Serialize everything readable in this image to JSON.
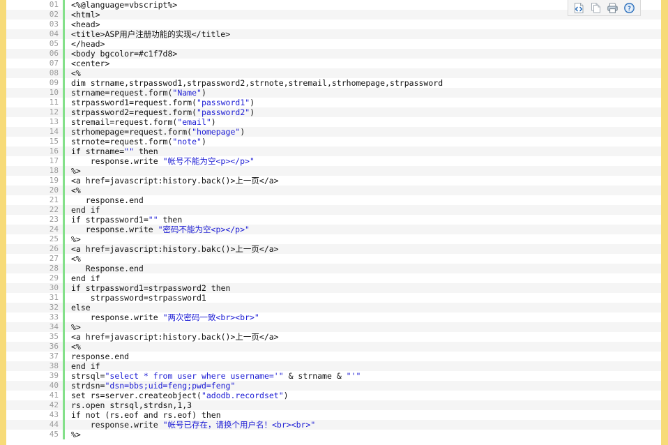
{
  "toolbar": {
    "buttons": [
      {
        "name": "view-source-icon",
        "label": "View Source",
        "color": "#2a6ebb"
      },
      {
        "name": "copy-icon",
        "label": "Copy",
        "color": "#9aa4ad"
      },
      {
        "name": "print-icon",
        "label": "Print",
        "color": "#7d8a96"
      },
      {
        "name": "help-icon",
        "label": "Help",
        "color": "#2a6ebb"
      }
    ]
  },
  "editor": {
    "language": "asp-vbscript",
    "line_number_start": 1,
    "line_number_format": "2-digit",
    "gutter_accent_color": "#84e08a",
    "edge_stripe_color": "#f7db78",
    "alt_row_color": "#f5f5f5",
    "string_color": "#1b1bd4",
    "text_color": "#101010",
    "line_number_color": "#999999",
    "lines": [
      {
        "n": "01",
        "parts": [
          {
            "t": "plain",
            "v": "<%@language=vbscript%>"
          }
        ]
      },
      {
        "n": "02",
        "parts": [
          {
            "t": "plain",
            "v": "<html>"
          }
        ]
      },
      {
        "n": "03",
        "parts": [
          {
            "t": "plain",
            "v": "<head>"
          }
        ]
      },
      {
        "n": "04",
        "parts": [
          {
            "t": "plain",
            "v": "<title>ASP用户注册功能的实现</title>"
          }
        ]
      },
      {
        "n": "05",
        "parts": [
          {
            "t": "plain",
            "v": "</head>"
          }
        ]
      },
      {
        "n": "06",
        "parts": [
          {
            "t": "plain",
            "v": "<body bgcolor=#c1f7d8>"
          }
        ]
      },
      {
        "n": "07",
        "parts": [
          {
            "t": "plain",
            "v": "<center>"
          }
        ]
      },
      {
        "n": "08",
        "parts": [
          {
            "t": "plain",
            "v": "<%"
          }
        ]
      },
      {
        "n": "09",
        "parts": [
          {
            "t": "plain",
            "v": "dim strname,strpasswod1,strpassword2,strnote,stremail,strhomepage,strpassword"
          }
        ]
      },
      {
        "n": "10",
        "parts": [
          {
            "t": "plain",
            "v": "strname=request.form("
          },
          {
            "t": "str",
            "v": "\"Name\""
          },
          {
            "t": "plain",
            "v": ")"
          }
        ]
      },
      {
        "n": "11",
        "parts": [
          {
            "t": "plain",
            "v": "strpassword1=request.form("
          },
          {
            "t": "str",
            "v": "\"password1\""
          },
          {
            "t": "plain",
            "v": ")"
          }
        ]
      },
      {
        "n": "12",
        "parts": [
          {
            "t": "plain",
            "v": "strpassword2=request.form("
          },
          {
            "t": "str",
            "v": "\"password2\""
          },
          {
            "t": "plain",
            "v": ")"
          }
        ]
      },
      {
        "n": "13",
        "parts": [
          {
            "t": "plain",
            "v": "stremail=request.form("
          },
          {
            "t": "str",
            "v": "\"email\""
          },
          {
            "t": "plain",
            "v": ")"
          }
        ]
      },
      {
        "n": "14",
        "parts": [
          {
            "t": "plain",
            "v": "strhomepage=request.form("
          },
          {
            "t": "str",
            "v": "\"homepage\""
          },
          {
            "t": "plain",
            "v": ")"
          }
        ]
      },
      {
        "n": "15",
        "parts": [
          {
            "t": "plain",
            "v": "strnote=request.form("
          },
          {
            "t": "str",
            "v": "\"note\""
          },
          {
            "t": "plain",
            "v": ")"
          }
        ]
      },
      {
        "n": "16",
        "parts": [
          {
            "t": "plain",
            "v": "if strname="
          },
          {
            "t": "str",
            "v": "\"\""
          },
          {
            "t": "plain",
            "v": " then"
          }
        ]
      },
      {
        "n": "17",
        "parts": [
          {
            "t": "plain",
            "v": "    response.write "
          },
          {
            "t": "str",
            "v": "\"帐号不能为空<p></p>\""
          }
        ]
      },
      {
        "n": "18",
        "parts": [
          {
            "t": "plain",
            "v": "%>"
          }
        ]
      },
      {
        "n": "19",
        "parts": [
          {
            "t": "plain",
            "v": "<a href=javascript:history.back()>上一页</a>"
          }
        ]
      },
      {
        "n": "20",
        "parts": [
          {
            "t": "plain",
            "v": "<%"
          }
        ]
      },
      {
        "n": "21",
        "parts": [
          {
            "t": "plain",
            "v": "   response.end"
          }
        ]
      },
      {
        "n": "22",
        "parts": [
          {
            "t": "plain",
            "v": "end if"
          }
        ]
      },
      {
        "n": "23",
        "parts": [
          {
            "t": "plain",
            "v": "if strpassword1="
          },
          {
            "t": "str",
            "v": "\"\""
          },
          {
            "t": "plain",
            "v": " then"
          }
        ]
      },
      {
        "n": "24",
        "parts": [
          {
            "t": "plain",
            "v": "   response.write "
          },
          {
            "t": "str",
            "v": "\"密码不能为空<p></p>\""
          }
        ]
      },
      {
        "n": "25",
        "parts": [
          {
            "t": "plain",
            "v": "%>"
          }
        ]
      },
      {
        "n": "26",
        "parts": [
          {
            "t": "plain",
            "v": "<a href=javascript:history.bakc()>上一页</a>"
          }
        ]
      },
      {
        "n": "27",
        "parts": [
          {
            "t": "plain",
            "v": "<%"
          }
        ]
      },
      {
        "n": "28",
        "parts": [
          {
            "t": "plain",
            "v": "   Response.end"
          }
        ]
      },
      {
        "n": "29",
        "parts": [
          {
            "t": "plain",
            "v": "end if"
          }
        ]
      },
      {
        "n": "30",
        "parts": [
          {
            "t": "plain",
            "v": "if strpassword1=strpassword2 then"
          }
        ]
      },
      {
        "n": "31",
        "parts": [
          {
            "t": "plain",
            "v": "    strpassword=strpassword1"
          }
        ]
      },
      {
        "n": "32",
        "parts": [
          {
            "t": "plain",
            "v": "else"
          }
        ]
      },
      {
        "n": "33",
        "parts": [
          {
            "t": "plain",
            "v": "    response.write "
          },
          {
            "t": "str",
            "v": "\"两次密码一致<br><br>\""
          }
        ]
      },
      {
        "n": "34",
        "parts": [
          {
            "t": "plain",
            "v": "%>"
          }
        ]
      },
      {
        "n": "35",
        "parts": [
          {
            "t": "plain",
            "v": "<a href=javascript:history.back()>上一页</a>"
          }
        ]
      },
      {
        "n": "36",
        "parts": [
          {
            "t": "plain",
            "v": "<%"
          }
        ]
      },
      {
        "n": "37",
        "parts": [
          {
            "t": "plain",
            "v": "response.end"
          }
        ]
      },
      {
        "n": "38",
        "parts": [
          {
            "t": "plain",
            "v": "end if"
          }
        ]
      },
      {
        "n": "39",
        "parts": [
          {
            "t": "plain",
            "v": "strsql="
          },
          {
            "t": "str",
            "v": "\"select * from user where username='\""
          },
          {
            "t": "plain",
            "v": " & strname & "
          },
          {
            "t": "str",
            "v": "\"'\""
          }
        ]
      },
      {
        "n": "40",
        "parts": [
          {
            "t": "plain",
            "v": "strdsn="
          },
          {
            "t": "str",
            "v": "\"dsn=bbs;uid=feng;pwd=feng\""
          }
        ]
      },
      {
        "n": "41",
        "parts": [
          {
            "t": "plain",
            "v": "set rs=server.createobject("
          },
          {
            "t": "str",
            "v": "\"adodb.recordset\""
          },
          {
            "t": "plain",
            "v": ")"
          }
        ]
      },
      {
        "n": "42",
        "parts": [
          {
            "t": "plain",
            "v": "rs.open strsql,strdsn,1,3"
          }
        ]
      },
      {
        "n": "43",
        "parts": [
          {
            "t": "plain",
            "v": "if not (rs.eof and rs.eof) then"
          }
        ]
      },
      {
        "n": "44",
        "parts": [
          {
            "t": "plain",
            "v": "    response.write "
          },
          {
            "t": "str",
            "v": "\"帐号已存在，请换个用户名！<br><br>\""
          }
        ]
      },
      {
        "n": "45",
        "parts": [
          {
            "t": "plain",
            "v": "%>"
          }
        ]
      }
    ]
  }
}
